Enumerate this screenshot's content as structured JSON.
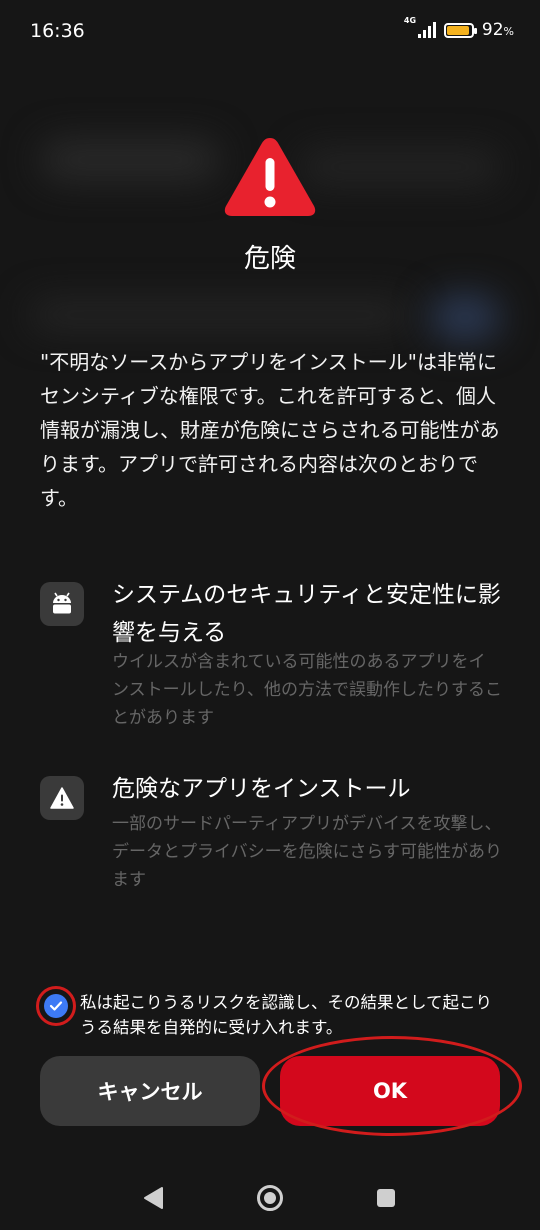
{
  "status_bar": {
    "time": "16:36",
    "network": "4G",
    "battery_percent": "92",
    "battery_unit": "%",
    "battery_level": 0.92
  },
  "dialog": {
    "icon": "warning-triangle-icon",
    "title": "危険",
    "description": "\"不明なソースからアプリをインストール\"は非常にセンシティブな権限です。これを許可すると、個人情報が漏洩し、財産が危険にさらされる可能性があります。アプリで許可される内容は次のとおりです。",
    "permissions": [
      {
        "icon": "android-robot-icon",
        "title": "システムのセキュリティと安定性に影響を与える",
        "description": "ウイルスが含まれている可能性のあるアプリをインストールしたり、他の方法で誤動作したりすることがあります"
      },
      {
        "icon": "warning-icon",
        "title": "危険なアプリをインストール",
        "description": "一部のサードパーティアプリがデバイスを攻撃し、データとプライバシーを危険にさらす可能性があります"
      }
    ],
    "consent": {
      "checked": true,
      "text": "私は起こりうるリスクを認識し、その結果として起こりうる結果を自発的に受け入れます。"
    },
    "buttons": {
      "cancel_label": "キャンセル",
      "ok_label": "OK"
    }
  },
  "colors": {
    "background": "#161616",
    "danger": "#e8222e",
    "ok_button": "#d3081c",
    "checkbox": "#3d7af5",
    "annotation": "#d11c1c"
  },
  "nav_bar": {
    "back_icon": "back-triangle-icon",
    "home_icon": "home-circle-icon",
    "recents_icon": "recents-square-icon"
  }
}
